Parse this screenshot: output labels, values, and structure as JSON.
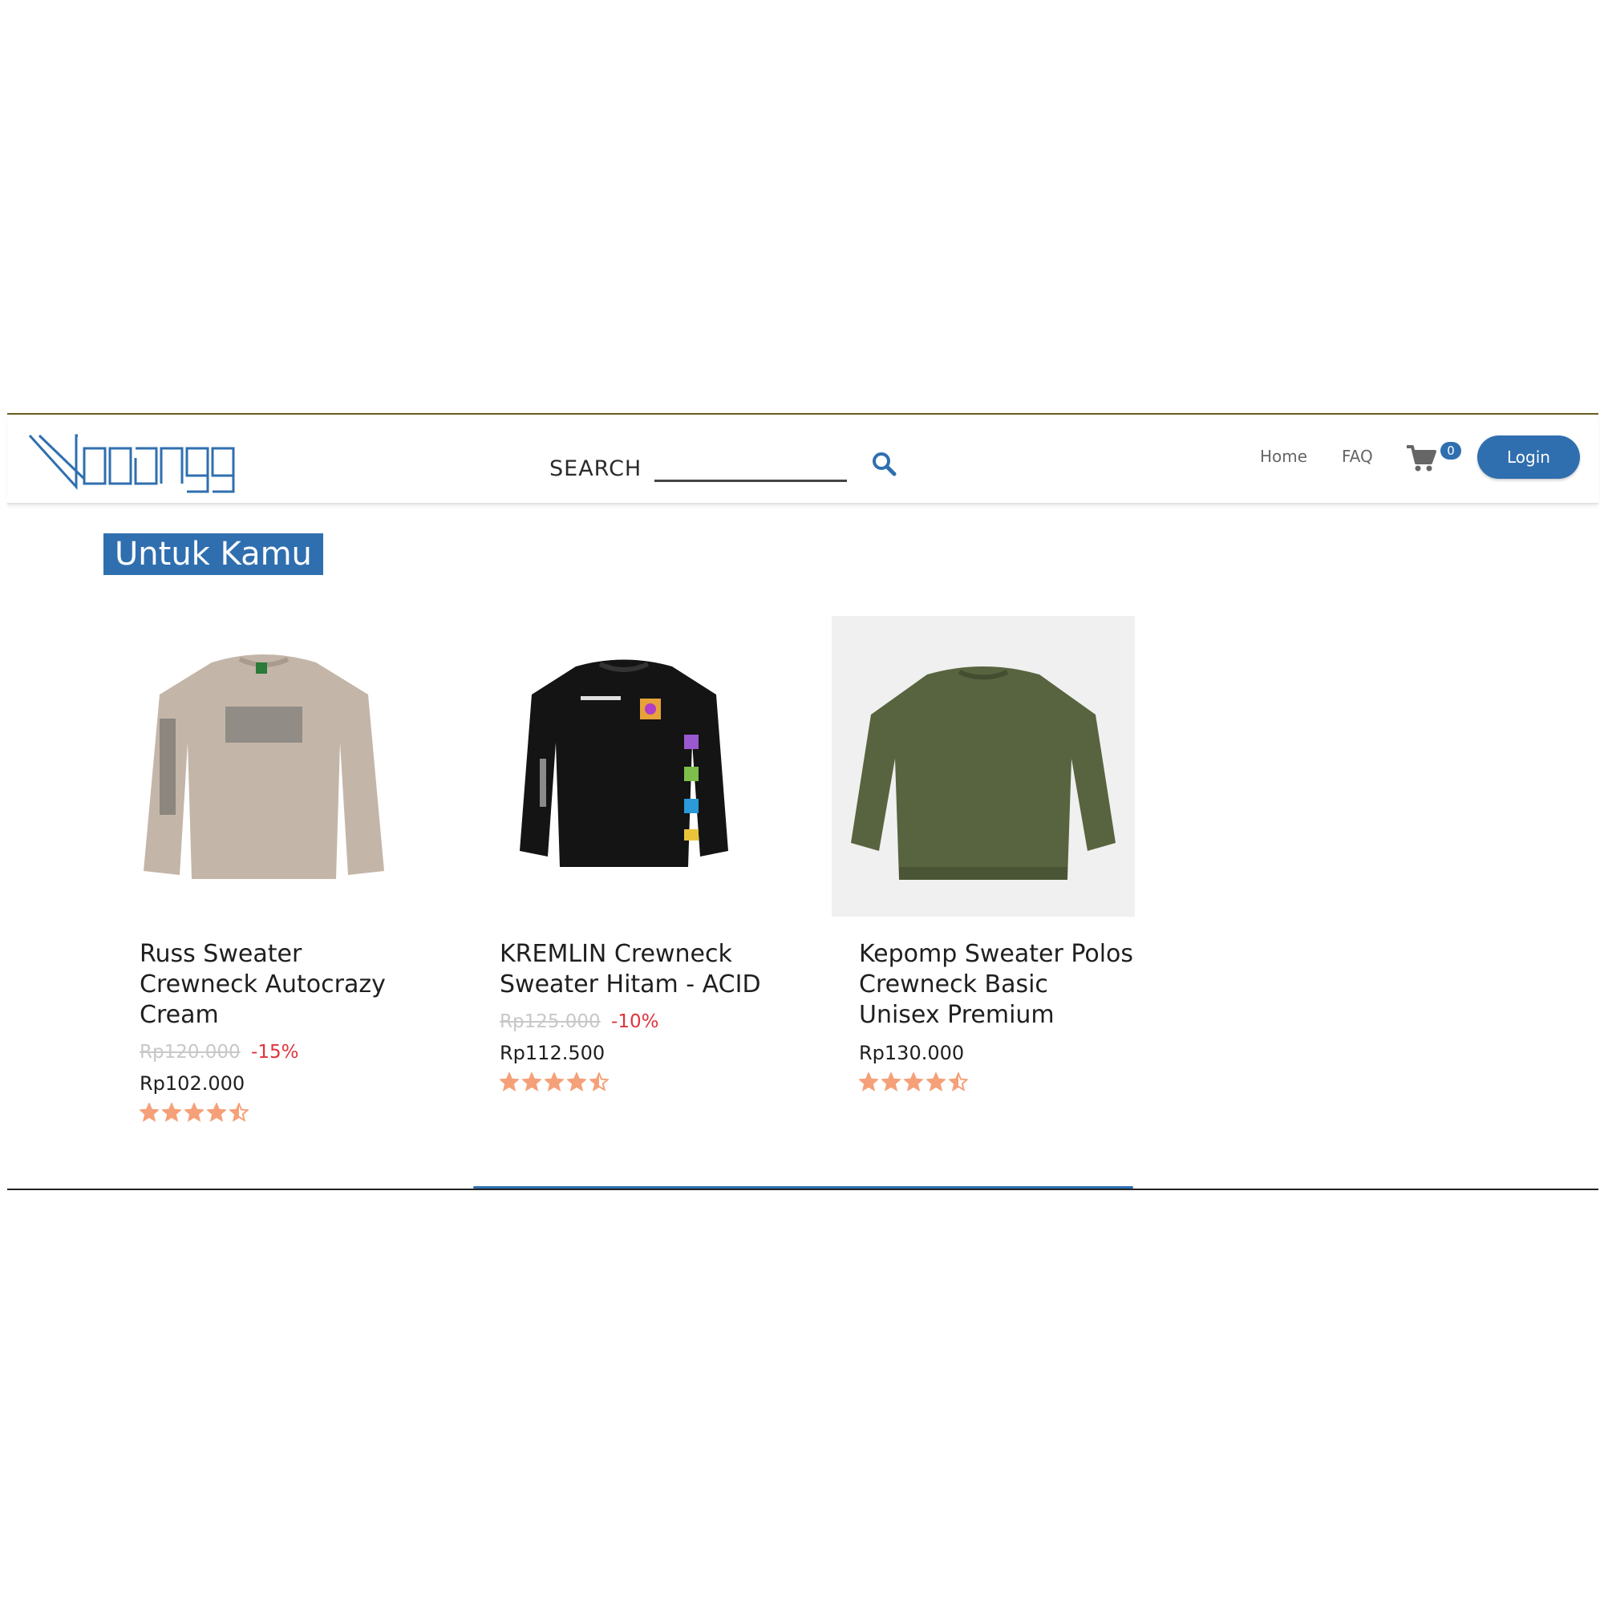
{
  "brand": {
    "accent": "#2f6faf",
    "logo_text": "Waaongg"
  },
  "search": {
    "label": "SEARCH",
    "placeholder": "",
    "value": ""
  },
  "nav": {
    "home": "Home",
    "faq": "FAQ",
    "cart_count": "0",
    "login": "Login"
  },
  "section": {
    "title": "Untuk Kamu"
  },
  "products": [
    {
      "name": "Russ Sweater Crewneck Autocrazy Cream",
      "price_old": "Rp120.000",
      "discount": "-15%",
      "price": "Rp102.000",
      "rating": 4.5,
      "color": "#c3b6a8"
    },
    {
      "name": "KREMLIN Crewneck Sweater Hitam - ACID",
      "price_old": "Rp125.000",
      "discount": "-10%",
      "price": "Rp112.500",
      "rating": 4.5,
      "color": "#141414"
    },
    {
      "name": "Kepomp Sweater Polos Crewneck Basic Unisex Premium",
      "price_old": "",
      "discount": "",
      "price": "Rp130.000",
      "rating": 4.5,
      "color": "#58643f"
    }
  ],
  "colors": {
    "star": "#f5a078",
    "discount": "#e0333c",
    "strike": "#c8c8c8"
  }
}
